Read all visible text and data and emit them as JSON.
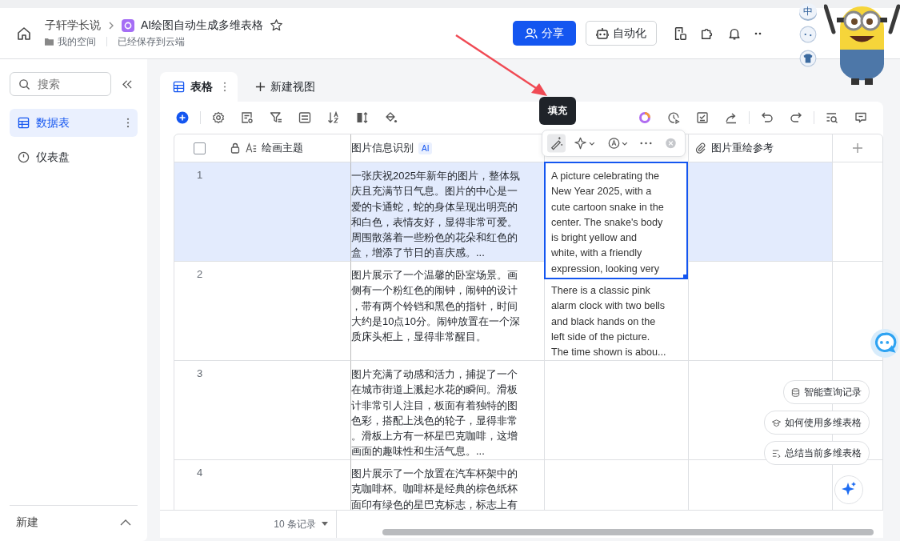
{
  "breadcrumb": {
    "parent": "子轩学长说",
    "title": "AI绘图自动生成多维表格",
    "location": "我的空间",
    "save_status": "已经保存到云端"
  },
  "header_actions": {
    "share": "分享",
    "automation": "自动化"
  },
  "ime_toolbar": {
    "label": "中"
  },
  "sidebar": {
    "search": {
      "placeholder": "搜索"
    },
    "items": [
      {
        "label": "数据表",
        "kind": "table",
        "selected": true
      },
      {
        "label": "仪表盘",
        "kind": "dashboard",
        "selected": false
      }
    ],
    "footer": "新建"
  },
  "tabs": [
    {
      "label": "表格",
      "selected": true
    }
  ],
  "new_view": "新建视图",
  "tooltip": "填充",
  "table": {
    "select_all": {
      "checked": false
    },
    "columns": [
      {
        "kind": "text",
        "label": "绘画主题"
      },
      {
        "kind": "ai",
        "label": "图片信息识别",
        "badge": "AI"
      },
      {
        "kind": "covered"
      },
      {
        "kind": "attachment",
        "label": "图片重绘参考"
      }
    ],
    "rows": [
      {
        "number": "1",
        "selected": true,
        "description": "一张庆祝2025年新年的图片，整体氛庆且充满节日气息。图片的中心是一爱的卡通蛇，蛇的身体呈现出明亮的和白色，表情友好，显得非常可爱。周围散落着一些粉色的花朵和红色的盒，增添了节日的喜庆感。...",
        "translation": "A picture celebrating the\nNew Year 2025, with a\ncute cartoon snake in the\ncenter. The snake's body\nis bright yellow and\nwhite, with a friendly\nexpression, looking very",
        "translation_selected": true
      },
      {
        "number": "2",
        "selected": false,
        "description": "图片展示了一个温馨的卧室场景。画侧有一个粉红色的闹钟，闹钟的设计，带有两个铃铛和黑色的指针，时间大约是10点10分。闹钟放置在一个深质床头柜上，显得非常醒目。",
        "translation": "There is a classic pink\nalarm clock with two bells\nand black hands on the\nleft side of the picture.\nThe time shown is abou...",
        "translation_selected": false
      },
      {
        "number": "3",
        "selected": false,
        "description": "图片充满了动感和活力，捕捉了一个在城市街道上溅起水花的瞬间。滑板计非常引人注目，板面有着独特的图色彩，搭配上浅色的轮子，显得非常。滑板上方有一杯星巴克咖啡，这增画面的趣味性和生活气息。..."
      },
      {
        "number": "4",
        "selected": false,
        "description": "图片展示了一个放置在汽车杯架中的克咖啡杯。咖啡杯是经典的棕色纸杯面印有绿色的星巴克标志，标志上有"
      }
    ]
  },
  "footer": {
    "record_count": "10 条记录"
  },
  "assistant": {
    "actions": [
      "智能查询记录",
      "如何使用多维表格",
      "总结当前多维表格"
    ]
  }
}
